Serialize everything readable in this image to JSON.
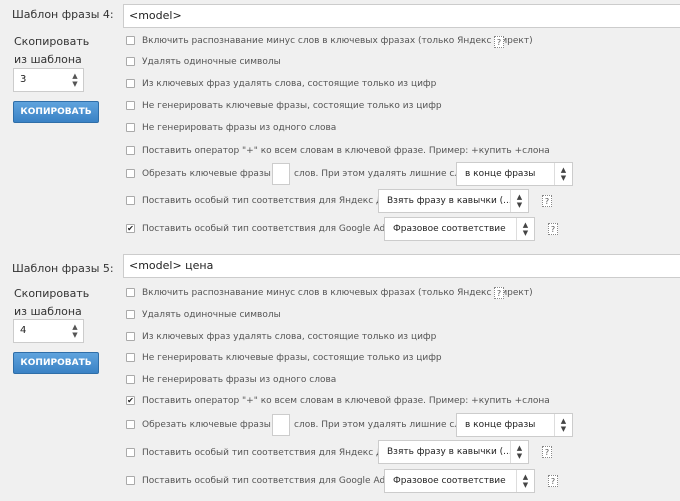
{
  "blocks": [
    {
      "label": "Шаблон фразы 4:",
      "phrase": "<model>",
      "copy_label_1": "Скопировать",
      "copy_label_2": "из шаблона",
      "copy_value": "3",
      "copy_button": "КОПИРОВАТЬ",
      "options": [
        {
          "text": "Включить распознавание минус слов в ключевых фразах (только Яндекс Директ)",
          "checked": false
        },
        {
          "text": "Удалять одиночные символы",
          "checked": false
        },
        {
          "text": "Из ключевых фраз удалять слова, состоящие только из цифр",
          "checked": false
        },
        {
          "text": "Не генерировать ключевые фразы, состоящие только из цифр",
          "checked": false
        },
        {
          "text": "Не генерировать фразы из одного слова",
          "checked": false
        },
        {
          "text": "Поставить оператор \"+\" ко всем словам в ключевой фразе. Пример: +купить +слона",
          "checked": false
        },
        {
          "text": "Обрезать ключевые фразы до",
          "checked": false
        },
        {
          "text": "Поставить особый тип соответствия для Яндекс Директ",
          "checked": false
        },
        {
          "text": "Поставить особый тип соответствия для Google AdWords",
          "checked": true
        }
      ],
      "trim_suffix": "слов. При этом удалять лишние слова",
      "trim_select": "в конце фразы",
      "yandex_select": "Взять фразу в кавычки (...",
      "google_select": "Фразовое соответствие",
      "help": "?"
    },
    {
      "label": "Шаблон фразы 5:",
      "phrase": "<model> цена",
      "copy_label_1": "Скопировать",
      "copy_label_2": "из шаблона",
      "copy_value": "4",
      "copy_button": "КОПИРОВАТЬ",
      "options": [
        {
          "text": "Включить распознавание минус слов в ключевых фразах (только Яндекс Директ)",
          "checked": false
        },
        {
          "text": "Удалять одиночные символы",
          "checked": false
        },
        {
          "text": "Из ключевых фраз удалять слова, состоящие только из цифр",
          "checked": false
        },
        {
          "text": "Не генерировать ключевые фразы, состоящие только из цифр",
          "checked": false
        },
        {
          "text": "Не генерировать фразы из одного слова",
          "checked": false
        },
        {
          "text": "Поставить оператор \"+\" ко всем словам в ключевой фразе. Пример: +купить +слона",
          "checked": true
        },
        {
          "text": "Обрезать ключевые фразы до",
          "checked": false
        },
        {
          "text": "Поставить особый тип соответствия для Яндекс Директ",
          "checked": false
        },
        {
          "text": "Поставить особый тип соответствия для Google AdWords",
          "checked": false
        }
      ],
      "trim_suffix": "слов. При этом удалять лишние слова",
      "trim_select": "в конце фразы",
      "yandex_select": "Взять фразу в кавычки (...",
      "google_select": "Фразовое соответствие",
      "help": "?"
    }
  ]
}
